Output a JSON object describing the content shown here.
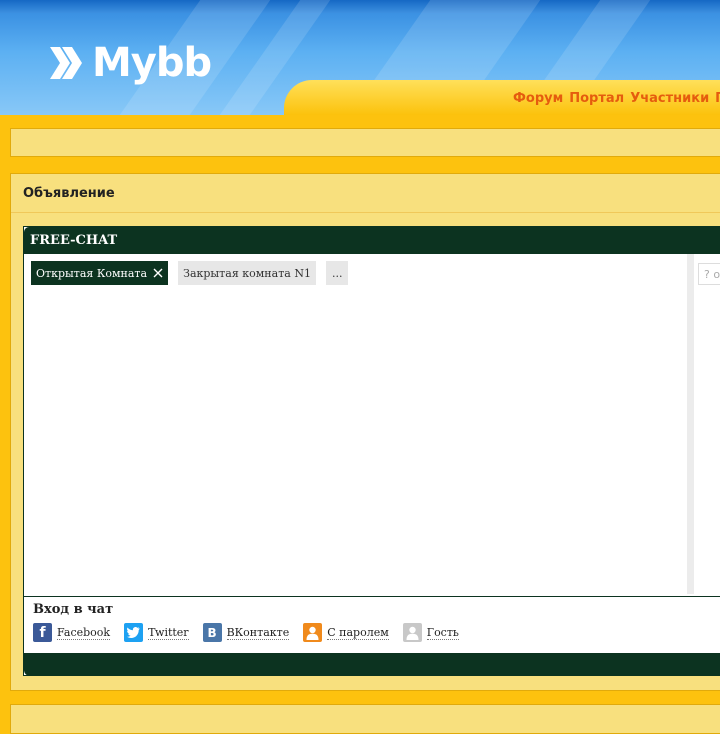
{
  "header": {
    "logo_text": "Mybb",
    "nav": [
      {
        "label": "Форум"
      },
      {
        "label": "Портал"
      },
      {
        "label": "Участники"
      },
      {
        "label": "П"
      }
    ]
  },
  "announcement": {
    "title": "Объявление"
  },
  "chat": {
    "title": "FREE-CHAT",
    "tabs": [
      {
        "label": "Открытая Комната",
        "active": true
      },
      {
        "label": "Закрытая комната N1",
        "active": false
      },
      {
        "label": "...",
        "active": false
      }
    ],
    "side_input_placeholder": "? о",
    "login": {
      "title": "Вход в чат",
      "options": [
        {
          "label": "Facebook",
          "icon": "facebook-icon",
          "color": "#3b5998"
        },
        {
          "label": "Twitter",
          "icon": "twitter-icon",
          "color": "#1da1f2"
        },
        {
          "label": "ВКонтакте",
          "icon": "vk-icon",
          "color": "#4a76a8"
        },
        {
          "label": "С паролем",
          "icon": "user-password-icon",
          "color": "#f08a1c"
        },
        {
          "label": "Гость",
          "icon": "guest-icon",
          "color": "#c8c8c8"
        }
      ]
    }
  },
  "colors": {
    "page_bg": "#fdc20e",
    "panel_bg": "#f8e07e",
    "chat_dark": "#0c3320",
    "nav_text": "#e55c0e"
  }
}
